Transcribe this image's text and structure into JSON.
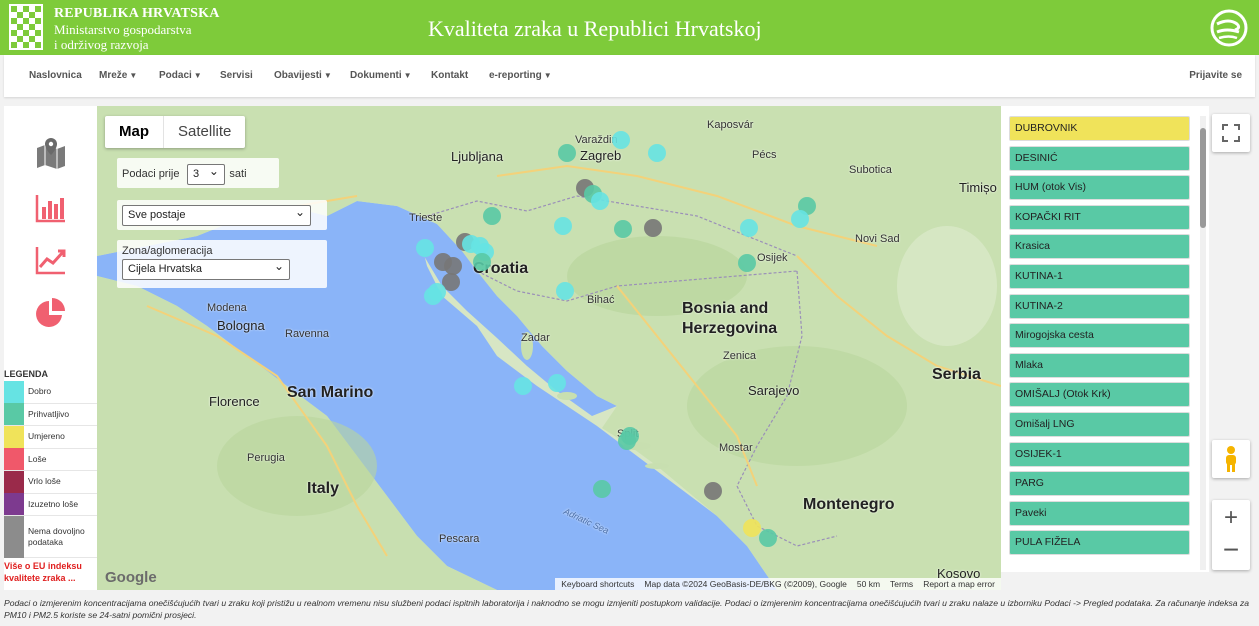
{
  "header": {
    "org_line1": "REPUBLIKA HRVATSKA",
    "org_line2": "Ministarstvo gospodarstva",
    "org_line3": "i održivog razvoja",
    "title": "Kvaliteta zraka u Republici Hrvatskoj"
  },
  "nav": {
    "items": [
      {
        "label": "Naslovnica",
        "dropdown": false
      },
      {
        "label": "Mreže",
        "dropdown": true
      },
      {
        "label": "Podaci",
        "dropdown": true
      },
      {
        "label": "Servisi",
        "dropdown": false
      },
      {
        "label": "Obavijesti",
        "dropdown": true
      },
      {
        "label": "Dokumenti",
        "dropdown": true
      },
      {
        "label": "Kontakt",
        "dropdown": false
      },
      {
        "label": "e-reporting",
        "dropdown": true
      }
    ],
    "login": "Prijavite se"
  },
  "tools": [
    "map-icon",
    "bar-chart-icon",
    "line-chart-icon",
    "pie-chart-icon"
  ],
  "legend": {
    "title": "LEGENDA",
    "items": [
      {
        "label": "Dobro",
        "color": "#66e3e3"
      },
      {
        "label": "Prihvatljivo",
        "color": "#59c9a5"
      },
      {
        "label": "Umjereno",
        "color": "#f0e35a"
      },
      {
        "label": "Loše",
        "color": "#f0586a"
      },
      {
        "label": "Vrlo loše",
        "color": "#9a2a4a"
      },
      {
        "label": "Izuzetno loše",
        "color": "#7d3a8f"
      },
      {
        "label": "Nema dovoljno podataka",
        "color": "#8c8c8c"
      }
    ],
    "link": "Više o EU indeksu kvalitete zraka ..."
  },
  "map": {
    "type_map": "Map",
    "type_satellite": "Satellite",
    "hours_label": "Podaci prije",
    "hours_value": "3",
    "hours_unit": "sati",
    "stations_select": "Sve postaje",
    "zone_label": "Zona/aglomeracija",
    "zone_value": "Cijela Hrvatska",
    "google": "Google",
    "footer": [
      "Keyboard shortcuts",
      "Map data ©2024 GeoBasis-DE/BKG (©2009), Google",
      "50 km",
      "Terms",
      "Report a map error"
    ],
    "labels": {
      "croatia": "Croatia",
      "bih1": "Bosnia and",
      "bih2": "Herzegovina",
      "serbia": "Serbia",
      "italy": "Italy",
      "sanmarino": "San Marino",
      "montenegro": "Montenegro",
      "kosovo": "Kosovo",
      "adriatic": "Adriatic Sea",
      "ljubljana": "Ljubljana",
      "zagreb": "Zagreb",
      "sarajevo": "Sarajevo",
      "bologna": "Bologna",
      "florence": "Florence",
      "zadar": "Zadar",
      "split": "Split",
      "mostar": "Mostar",
      "pecs": "Pécs",
      "subotica": "Subotica",
      "novisad": "Novi Sad",
      "timisoara": "Timișo",
      "pescara": "Pescara",
      "trieste": "Trieste",
      "osijek": "Osijek",
      "bihac": "Bihać",
      "zenica": "Zenica",
      "ravenna": "Ravenna",
      "modena": "Modena",
      "perugia": "Perugia",
      "varazdin": "Varaždin",
      "kaposvar": "Kaposvár"
    }
  },
  "stations": [
    {
      "name": "DUBROVNIK",
      "color": "#f0e35a"
    },
    {
      "name": "DESINIĆ",
      "color": "#59c9a5"
    },
    {
      "name": "HUM (otok Vis)",
      "color": "#59c9a5"
    },
    {
      "name": "KOPAČKI RIT",
      "color": "#59c9a5"
    },
    {
      "name": "Krasica",
      "color": "#59c9a5"
    },
    {
      "name": "KUTINA-1",
      "color": "#59c9a5"
    },
    {
      "name": "KUTINA-2",
      "color": "#59c9a5"
    },
    {
      "name": "Mirogojska cesta",
      "color": "#59c9a5"
    },
    {
      "name": "Mlaka",
      "color": "#59c9a5"
    },
    {
      "name": "OMIŠALJ (Otok Krk)",
      "color": "#59c9a5"
    },
    {
      "name": "Omišalj LNG",
      "color": "#59c9a5"
    },
    {
      "name": "OSIJEK-1",
      "color": "#59c9a5"
    },
    {
      "name": "PARG",
      "color": "#59c9a5"
    },
    {
      "name": "Paveki",
      "color": "#59c9a5"
    },
    {
      "name": "PULA FIŽELA",
      "color": "#59c9a5"
    }
  ],
  "markers": [
    {
      "station": "dobro",
      "color": "#66e3e3"
    },
    {
      "station": "prihvatljivo",
      "color": "#59c9a5"
    },
    {
      "station": "umjereno",
      "color": "#f0e35a"
    },
    {
      "station": "nema",
      "color": "#777777"
    }
  ],
  "footnote": "Podaci o izmjerenim koncentracijama onečišćujućih tvari u zraku koji pristižu u realnom vremenu nisu službeni podaci ispitnih laboratorija i naknodno se mogu izmjeniti postupkom validacije. Podaci o izmjerenim koncentracijama onečišćujućih tvari u zraku nalaze u izborniku Podaci -> Pregled podataka. Za računanje indeksa za PM10 i PM2.5 koriste se 24-satni pomični prosjeci."
}
